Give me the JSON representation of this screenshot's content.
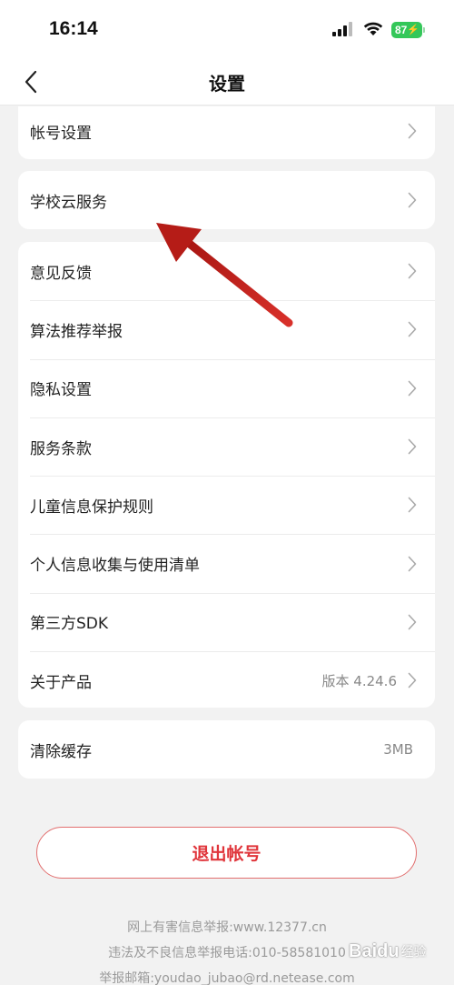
{
  "status_bar": {
    "time": "16:14",
    "battery": "87",
    "icons": [
      "signal-icon",
      "wifi-icon",
      "battery-icon"
    ]
  },
  "nav": {
    "title": "设置",
    "back_icon": "chevron-left-icon"
  },
  "groups": {
    "account": {
      "label": "帐号设置"
    },
    "school_cloud": {
      "label": "学校云服务"
    },
    "main": [
      {
        "label": "意见反馈"
      },
      {
        "label": "算法推荐举报"
      },
      {
        "label": "隐私设置"
      },
      {
        "label": "服务条款"
      },
      {
        "label": "儿童信息保护规则"
      },
      {
        "label": "个人信息收集与使用清单"
      },
      {
        "label": "第三方SDK"
      },
      {
        "label": "关于产品",
        "value": "版本 4.24.6"
      }
    ],
    "cache": {
      "label": "清除缓存",
      "value": "3MB"
    }
  },
  "logout_label": "退出帐号",
  "footer": {
    "line1": "网上有害信息举报:www.12377.cn",
    "line2": "违法及不良信息举报电话:010-58581010",
    "line3": "举报邮箱:youdao_jubao@rd.netease.com"
  },
  "watermark": {
    "brand": "Baidu",
    "sub": "经验"
  },
  "colors": {
    "accent": "#e0353b",
    "battery": "#34c759",
    "annotation_arrow": "#c8201c",
    "background": "#f2f2f2"
  }
}
